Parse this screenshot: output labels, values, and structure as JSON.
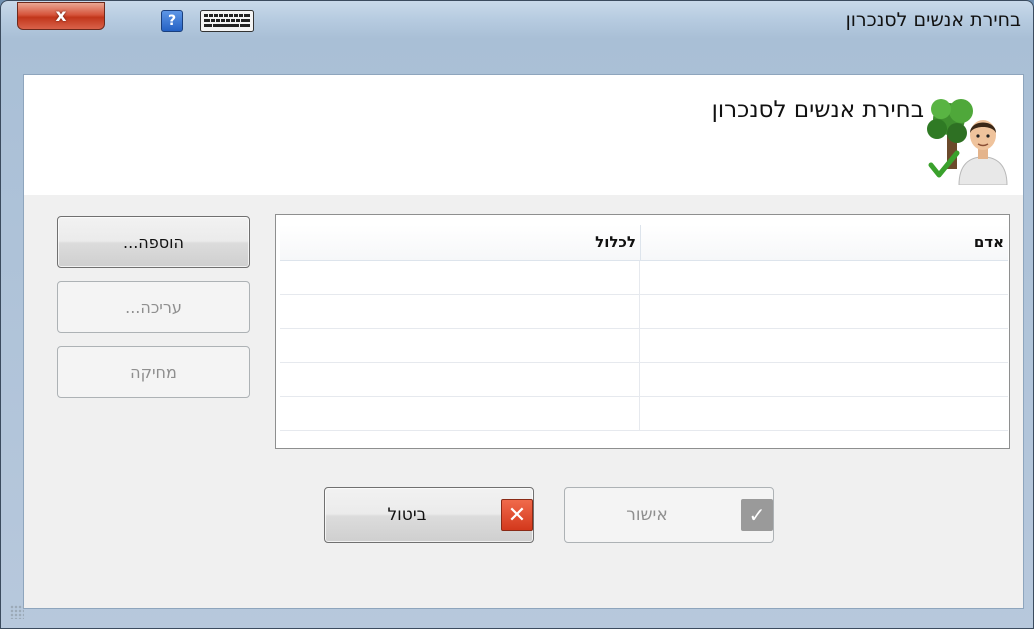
{
  "window": {
    "title": "בחירת אנשים לסנכרון",
    "close_label": "x"
  },
  "titlebar_icons": {
    "help": "?",
    "keyboard": "keyboard-icon"
  },
  "header": {
    "title": "בחירת אנשים לסנכרון",
    "icon": "tree-person-check-icon"
  },
  "table": {
    "columns": [
      "אדם",
      "לכלול"
    ],
    "rows": [
      [
        "",
        ""
      ],
      [
        "",
        ""
      ],
      [
        "",
        ""
      ],
      [
        "",
        ""
      ],
      [
        "",
        ""
      ]
    ]
  },
  "side_buttons": {
    "add_label": "הוספה...",
    "edit_label": "עריכה...",
    "delete_label": "מחיקה"
  },
  "dialog_buttons": {
    "cancel_label": "ביטול",
    "ok_label": "אישור"
  },
  "colors": {
    "accent_close": "#c1361b",
    "cancel_icon": "#d3381c",
    "disabled_text": "#8f8f8f"
  }
}
